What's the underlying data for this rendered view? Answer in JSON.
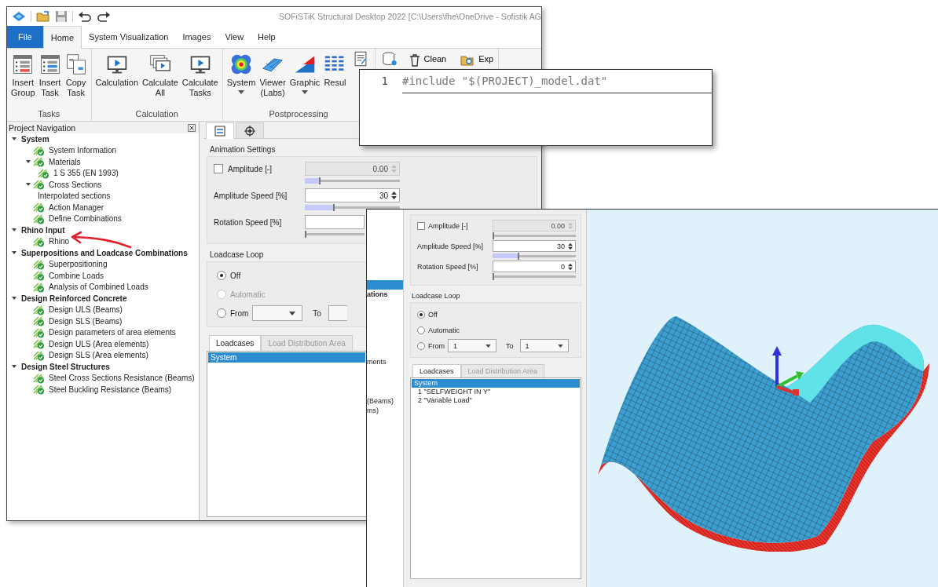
{
  "main_window": {
    "title": "SOFiSTiK Structural Desktop 2022  [C:\\Users\\fhe\\OneDrive - Sofistik AG",
    "ribbon_tabs": [
      {
        "label": "File",
        "kind": "file",
        "selected": false
      },
      {
        "label": "Home",
        "kind": "tab",
        "selected": true
      },
      {
        "label": "System Visualization",
        "kind": "tab",
        "selected": false
      },
      {
        "label": "Images",
        "kind": "tab",
        "selected": false
      },
      {
        "label": "View",
        "kind": "tab",
        "selected": false
      },
      {
        "label": "Help",
        "kind": "tab",
        "selected": false
      }
    ],
    "ribbon_groups": [
      {
        "label": "Tasks",
        "buttons": [
          {
            "label": "Insert\nGroup",
            "dropdown": false
          },
          {
            "label": "Insert\nTask",
            "dropdown": false
          },
          {
            "label": "Copy\nTask",
            "dropdown": false
          }
        ]
      },
      {
        "label": "Calculation",
        "buttons": [
          {
            "label": "Calculation",
            "dropdown": false
          },
          {
            "label": "Calculate\nAll",
            "dropdown": false
          },
          {
            "label": "Calculate\nTasks",
            "dropdown": false
          }
        ]
      },
      {
        "label": "Postprocessing",
        "buttons": [
          {
            "label": "System",
            "dropdown": true
          },
          {
            "label": "Viewer\n(Labs)",
            "dropdown": false
          },
          {
            "label": "Graphic",
            "dropdown": true
          },
          {
            "label": "Resul",
            "dropdown": false
          },
          {
            "dropdown": false
          }
        ]
      },
      {
        "buttons": [
          {
            "dropdown": false
          }
        ],
        "small_buttons": [
          {
            "label": "Clean"
          },
          {
            "label": "Exp"
          }
        ]
      }
    ],
    "navigation": {
      "title": "Project Navigation",
      "items": [
        {
          "label": "System",
          "expanded": true,
          "children": [
            {
              "label": "System Information",
              "kind": "icon"
            },
            {
              "label": "Materials",
              "kind": "icon",
              "expanded": true,
              "children": [
                {
                  "label": "1 S 355 (EN 1993)",
                  "kind": "icon"
                }
              ]
            },
            {
              "label": "Cross Sections",
              "kind": "icon",
              "expanded": true,
              "children": [
                {
                  "label": "Interpolated sections",
                  "kind": "text"
                }
              ]
            },
            {
              "label": "Action Manager",
              "kind": "icon"
            },
            {
              "label": "Define Combinations",
              "kind": "icon"
            }
          ]
        },
        {
          "label": "Rhino Input",
          "expanded": true,
          "children": [
            {
              "label": "Rhino",
              "kind": "icon"
            }
          ]
        },
        {
          "label": "Superpositions and Loadcase Combinations",
          "expanded": true,
          "children": [
            {
              "label": "Superpositioning",
              "kind": "icon"
            },
            {
              "label": "Combine Loads",
              "kind": "icon"
            },
            {
              "label": "Analysis of Combined Loads",
              "kind": "icon"
            }
          ]
        },
        {
          "label": "Design Reinforced Concrete",
          "expanded": true,
          "children": [
            {
              "label": "Design ULS (Beams)",
              "kind": "icon"
            },
            {
              "label": "Design SLS (Beams)",
              "kind": "icon"
            },
            {
              "label": "Design parameters of area elements",
              "kind": "icon"
            },
            {
              "label": "Design ULS (Area elements)",
              "kind": "icon"
            },
            {
              "label": "Design SLS (Area elements)",
              "kind": "icon"
            }
          ]
        },
        {
          "label": "Design Steel Structures",
          "expanded": true,
          "children": [
            {
              "label": "Steel Cross Sections Resistance (Beams)",
              "kind": "icon"
            },
            {
              "label": "Steel Buckling Resistance (Beams)",
              "kind": "icon"
            }
          ]
        }
      ]
    },
    "panel": {
      "tabs": [
        {
          "selected": true
        },
        {
          "selected": false
        }
      ],
      "animation_title": "Animation Settings",
      "animation": [
        {
          "label": "Amplitude [-]",
          "kind": "checkbox",
          "checked": false,
          "value": "0.00",
          "disabled": true,
          "level": 0.15
        },
        {
          "label": "Amplitude Speed [%]",
          "kind": "plain",
          "value": "30",
          "disabled": false,
          "level": 0.3
        },
        {
          "label": "Rotation Speed [%]",
          "kind": "plain",
          "disabled": false,
          "level": 0
        }
      ],
      "loop_title": "Loadcase Loop",
      "loop_options": [
        {
          "label": "Off",
          "kind": "radio",
          "selected": true,
          "disabled": false
        },
        {
          "label": "Automatic",
          "kind": "radio",
          "selected": false,
          "disabled": true
        },
        {
          "label": "From",
          "kind": "range",
          "selected": false,
          "disabled": false,
          "to_label": "To"
        }
      ],
      "list_tabs": [
        {
          "label": "Loadcases",
          "selected": true,
          "disabled": false
        },
        {
          "label": "Load Distribution Area",
          "selected": false,
          "disabled": true
        }
      ],
      "loadcases": [
        {
          "label": "System",
          "selected": true
        }
      ]
    }
  },
  "code_window": {
    "lines": [
      {
        "number": "1",
        "code": "#include \"$(PROJECT)_model.dat\""
      }
    ]
  },
  "viewer_window": {
    "tree_rows": [
      {
        "selected": true
      },
      {
        "text": "ations",
        "bold": true,
        "selected": false
      },
      {
        "text": "ments",
        "bold": false,
        "selected": false
      },
      {
        "text": "(Beams)",
        "bold": false,
        "selected": false
      },
      {
        "text": "ms)",
        "bold": false,
        "selected": false
      }
    ],
    "panel": {
      "animation": [
        {
          "label": "Amplitude [-]",
          "kind": "checkbox",
          "checked": false,
          "value": "0.00",
          "disabled": true,
          "level": 0
        },
        {
          "label": "Amplitude Speed [%]",
          "kind": "plain",
          "value": "30",
          "disabled": false,
          "level": 0.3
        },
        {
          "label": "Rotation Speed [%]",
          "kind": "plain",
          "value": "0",
          "disabled": false,
          "level": 0
        }
      ],
      "loop_title": "Loadcase Loop",
      "loop_options": [
        {
          "label": "Off",
          "kind": "radio",
          "selected": true,
          "disabled": false
        },
        {
          "label": "Automatic",
          "kind": "radio",
          "selected": false,
          "disabled": false
        },
        {
          "label": "From",
          "kind": "range",
          "selected": false,
          "disabled": false,
          "from_value": "1",
          "to_label": "To",
          "to_value": "1"
        }
      ],
      "list_tabs": [
        {
          "label": "Loadcases",
          "selected": true,
          "disabled": false
        },
        {
          "label": "Load Distribution Area",
          "selected": false,
          "disabled": true
        }
      ],
      "loadcases": [
        {
          "label": "System",
          "selected": true
        },
        {
          "label": "1 \"SELFWEIGHT IN Y\"",
          "selected": false
        },
        {
          "label": "2 \"Variable Load\"",
          "selected": false
        }
      ]
    }
  }
}
